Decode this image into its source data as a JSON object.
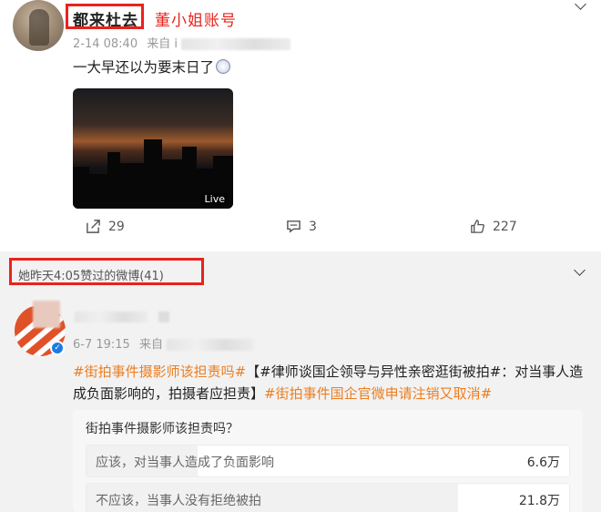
{
  "post1": {
    "author": "都来杜去",
    "owner_tag": "董小姐账号",
    "time": "2-14 08:40",
    "source_prefix": "来自 i",
    "text": "一大早还以为要末日了",
    "live_label": "Live",
    "reposts": "29",
    "comments": "3",
    "likes": "227"
  },
  "liked_section": {
    "label": "她昨天4:05赞过的微博(41)"
  },
  "post2": {
    "time": "6-7 19:15",
    "source_prefix": "来自",
    "tag1": "#街拍事件摄影师该担责吗#",
    "bracket_text": "【#律师谈国企领导与异性亲密逛街被拍#：对当事人造成负面影响的，拍摄者应担责】",
    "tag2": "#街拍事件国企官微申请注销又取消#",
    "poll": {
      "question": "街拍事件摄影师该担责吗？",
      "options": [
        {
          "label": "应该，对当事人造成了负面影响",
          "count": "6.6万",
          "fraction": 0.23
        },
        {
          "label": "不应该，当事人没有拒绝被拍",
          "count": "21.8万",
          "fraction": 0.77
        }
      ]
    }
  },
  "colors": {
    "highlight_red": "#e8231c",
    "topic_orange": "#ec7d20",
    "verified_blue": "#1b7ce3"
  }
}
